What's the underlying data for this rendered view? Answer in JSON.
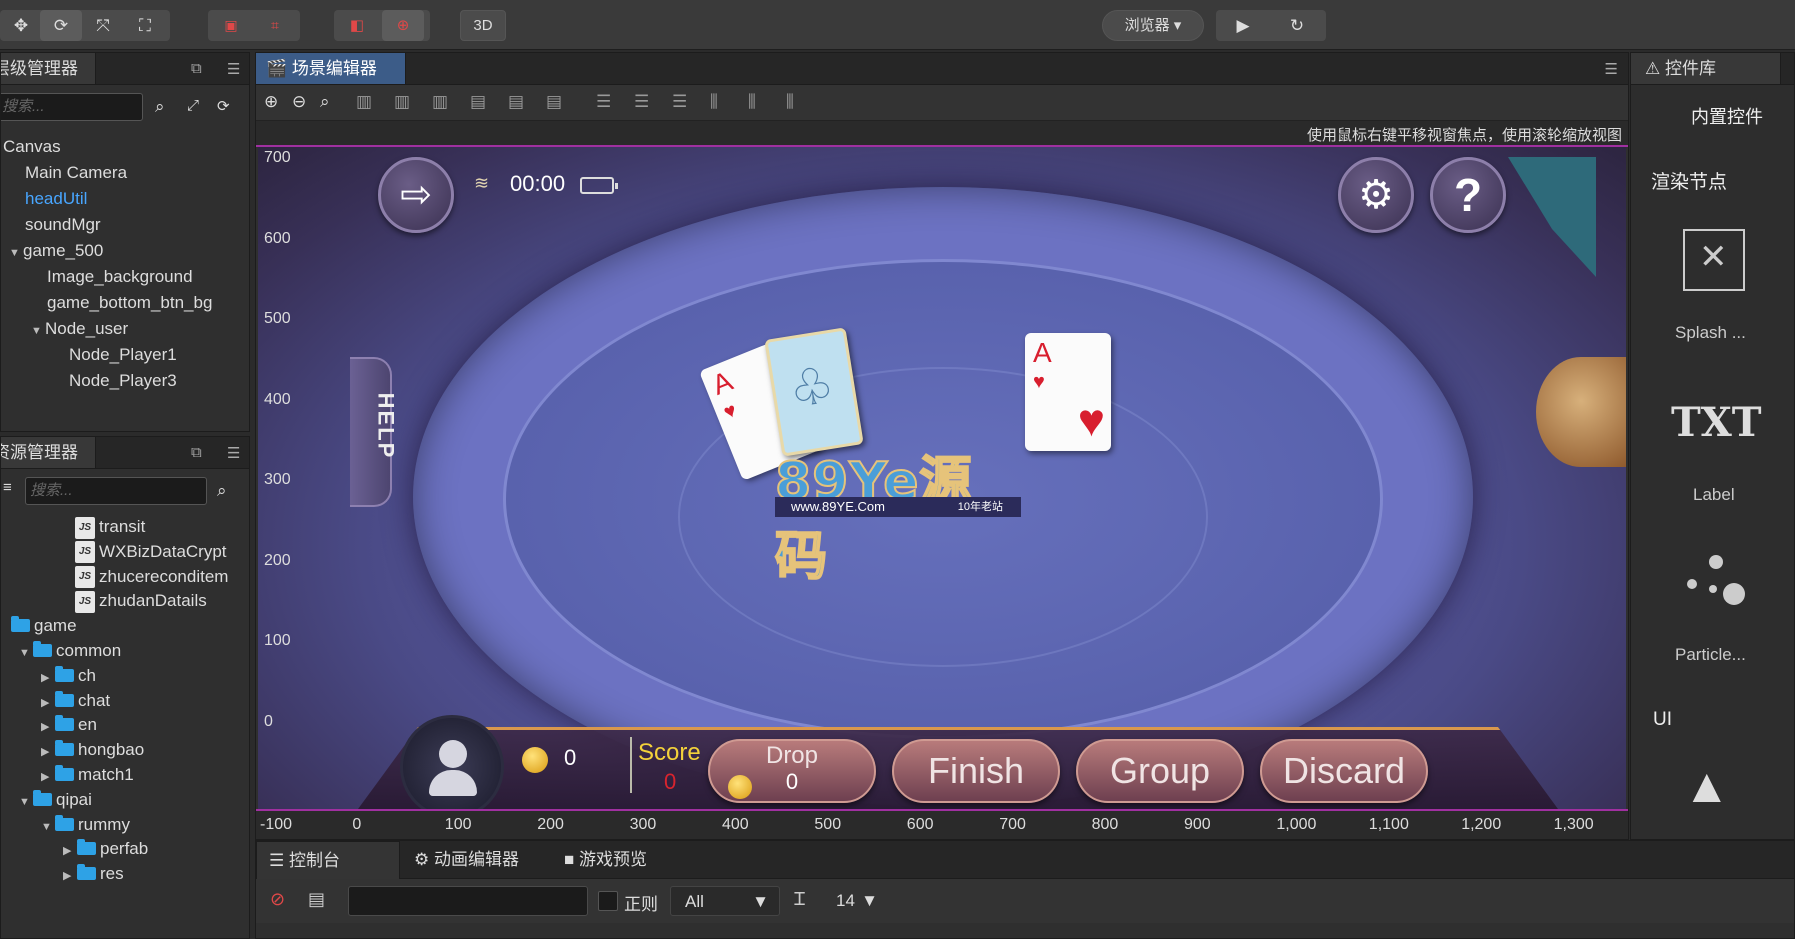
{
  "toolbar": {
    "tools_left": [
      "✥",
      "⟳",
      "⤧",
      "⛶"
    ],
    "btn_3d": "3D",
    "browser": "浏览器 ▾",
    "play": "▶",
    "refresh": "↻"
  },
  "hierarchy": {
    "title": "层级管理器",
    "search_placeholder": "搜索...",
    "nodes": [
      {
        "label": "Canvas",
        "depth": 0,
        "arrow": ""
      },
      {
        "label": "Main Camera",
        "depth": 1,
        "arrow": ""
      },
      {
        "label": "headUtil",
        "depth": 1,
        "arrow": "",
        "selected": true
      },
      {
        "label": "soundMgr",
        "depth": 1,
        "arrow": ""
      },
      {
        "label": "game_500",
        "depth": 1,
        "arrow": "▼"
      },
      {
        "label": "Image_background",
        "depth": 2,
        "arrow": ""
      },
      {
        "label": "game_bottom_btn_bg",
        "depth": 2,
        "arrow": ""
      },
      {
        "label": "Node_user",
        "depth": 2,
        "arrow": "▼"
      },
      {
        "label": "Node_Player1",
        "depth": 3,
        "arrow": ""
      },
      {
        "label": "Node_Player3",
        "depth": 3,
        "arrow": ""
      }
    ]
  },
  "assets": {
    "title": "资源管理器",
    "search_placeholder": "搜索...",
    "items": [
      {
        "label": "transit",
        "type": "js",
        "depth": 3
      },
      {
        "label": "WXBizDataCrypt",
        "type": "js",
        "depth": 3
      },
      {
        "label": "zhucereconditem",
        "type": "js",
        "depth": 3
      },
      {
        "label": "zhudanDatails",
        "type": "js",
        "depth": 3
      },
      {
        "label": "game",
        "type": "folder",
        "depth": 0,
        "arrow": ""
      },
      {
        "label": "common",
        "type": "folder",
        "depth": 1,
        "arrow": "▼"
      },
      {
        "label": "ch",
        "type": "folder",
        "depth": 2,
        "arrow": "▶"
      },
      {
        "label": "chat",
        "type": "folder",
        "depth": 2,
        "arrow": "▶"
      },
      {
        "label": "en",
        "type": "folder",
        "depth": 2,
        "arrow": "▶"
      },
      {
        "label": "hongbao",
        "type": "folder",
        "depth": 2,
        "arrow": "▶"
      },
      {
        "label": "match1",
        "type": "folder",
        "depth": 2,
        "arrow": "▶"
      },
      {
        "label": "qipai",
        "type": "folder",
        "depth": 1,
        "arrow": "▼"
      },
      {
        "label": "rummy",
        "type": "folder",
        "depth": 2,
        "arrow": "▼"
      },
      {
        "label": "perfab",
        "type": "folder",
        "depth": 3,
        "arrow": "▶"
      },
      {
        "label": "res",
        "type": "folder",
        "depth": 3,
        "arrow": "▶"
      }
    ]
  },
  "scene": {
    "tab": "场景编辑器",
    "hint": "使用鼠标右键平移视窗焦点，使用滚轮缩放视图",
    "y_ticks": [
      "700",
      "600",
      "500",
      "400",
      "300",
      "200",
      "100",
      "0"
    ],
    "x_ticks": [
      "-100",
      "0",
      "100",
      "200",
      "300",
      "400",
      "500",
      "600",
      "700",
      "800",
      "900",
      "1,000",
      "1,100",
      "1,200",
      "1,300"
    ]
  },
  "game": {
    "clock": "00:00",
    "help": "HELP",
    "card_rank_1": "A",
    "card_rank_2": "A",
    "suit": "♥",
    "coin_value": "0",
    "score_label": "Score",
    "score_value": "0",
    "drop_label": "Drop",
    "drop_value": "0",
    "finish_label": "Finish",
    "group_label": "Group",
    "discard_label": "Discard",
    "watermark_logo": "89Ye源码",
    "watermark_url": "www.89YE.Com",
    "watermark_tag": "10年老站"
  },
  "widgets": {
    "title": "控件库",
    "builtin": "内置控件",
    "render_nodes": "渲染节点",
    "splash": "Splash ...",
    "txt": "TXT",
    "label": "Label",
    "particle": "Particle...",
    "ui": "UI"
  },
  "console": {
    "tabs": [
      "控制台",
      "动画编辑器",
      "游戏预览"
    ],
    "regex": "正则",
    "level": "All",
    "font_size": "14"
  }
}
